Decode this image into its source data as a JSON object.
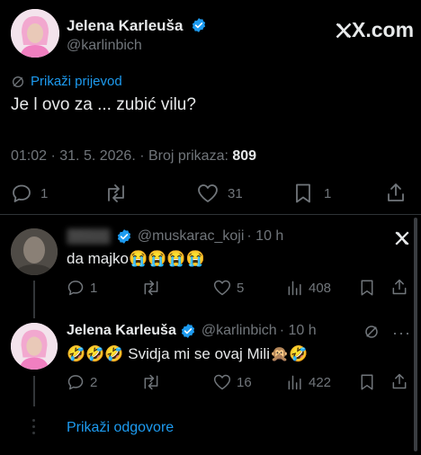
{
  "main_tweet": {
    "author_name": "Jelena Karleuša",
    "handle": "@karlinbich",
    "brand": "X.com",
    "translate_label": "Prikaži prijevod",
    "text": "Je l ovo za ... zubić vilu?",
    "meta_time": "01:02 · 31. 5. 2026. · Broj prikaza:",
    "meta_views": "809",
    "actions": {
      "replies": "1",
      "retweets": "",
      "likes": "31",
      "bookmarks": "1"
    }
  },
  "reply1": {
    "author_name": "Milos",
    "handle": "@muskarac_koji",
    "time": "· 10 h",
    "text": "da majko😭😭😭😭",
    "actions": {
      "replies": "1",
      "retweets": "",
      "likes": "5",
      "views": "408"
    }
  },
  "reply2": {
    "author_name": "Jelena Karleuša",
    "handle": "@karlinbich",
    "time": "· 10 h",
    "text": "🤣🤣🤣 Svidja mi se ovaj Mili🙊🤣",
    "actions": {
      "replies": "2",
      "retweets": "",
      "likes": "16",
      "views": "422"
    }
  },
  "show_replies_label": "Prikaži odgovore",
  "colors": {
    "accent": "#1d9bf0",
    "muted": "#71767b",
    "text": "#e7e9ea",
    "background": "#000000"
  }
}
